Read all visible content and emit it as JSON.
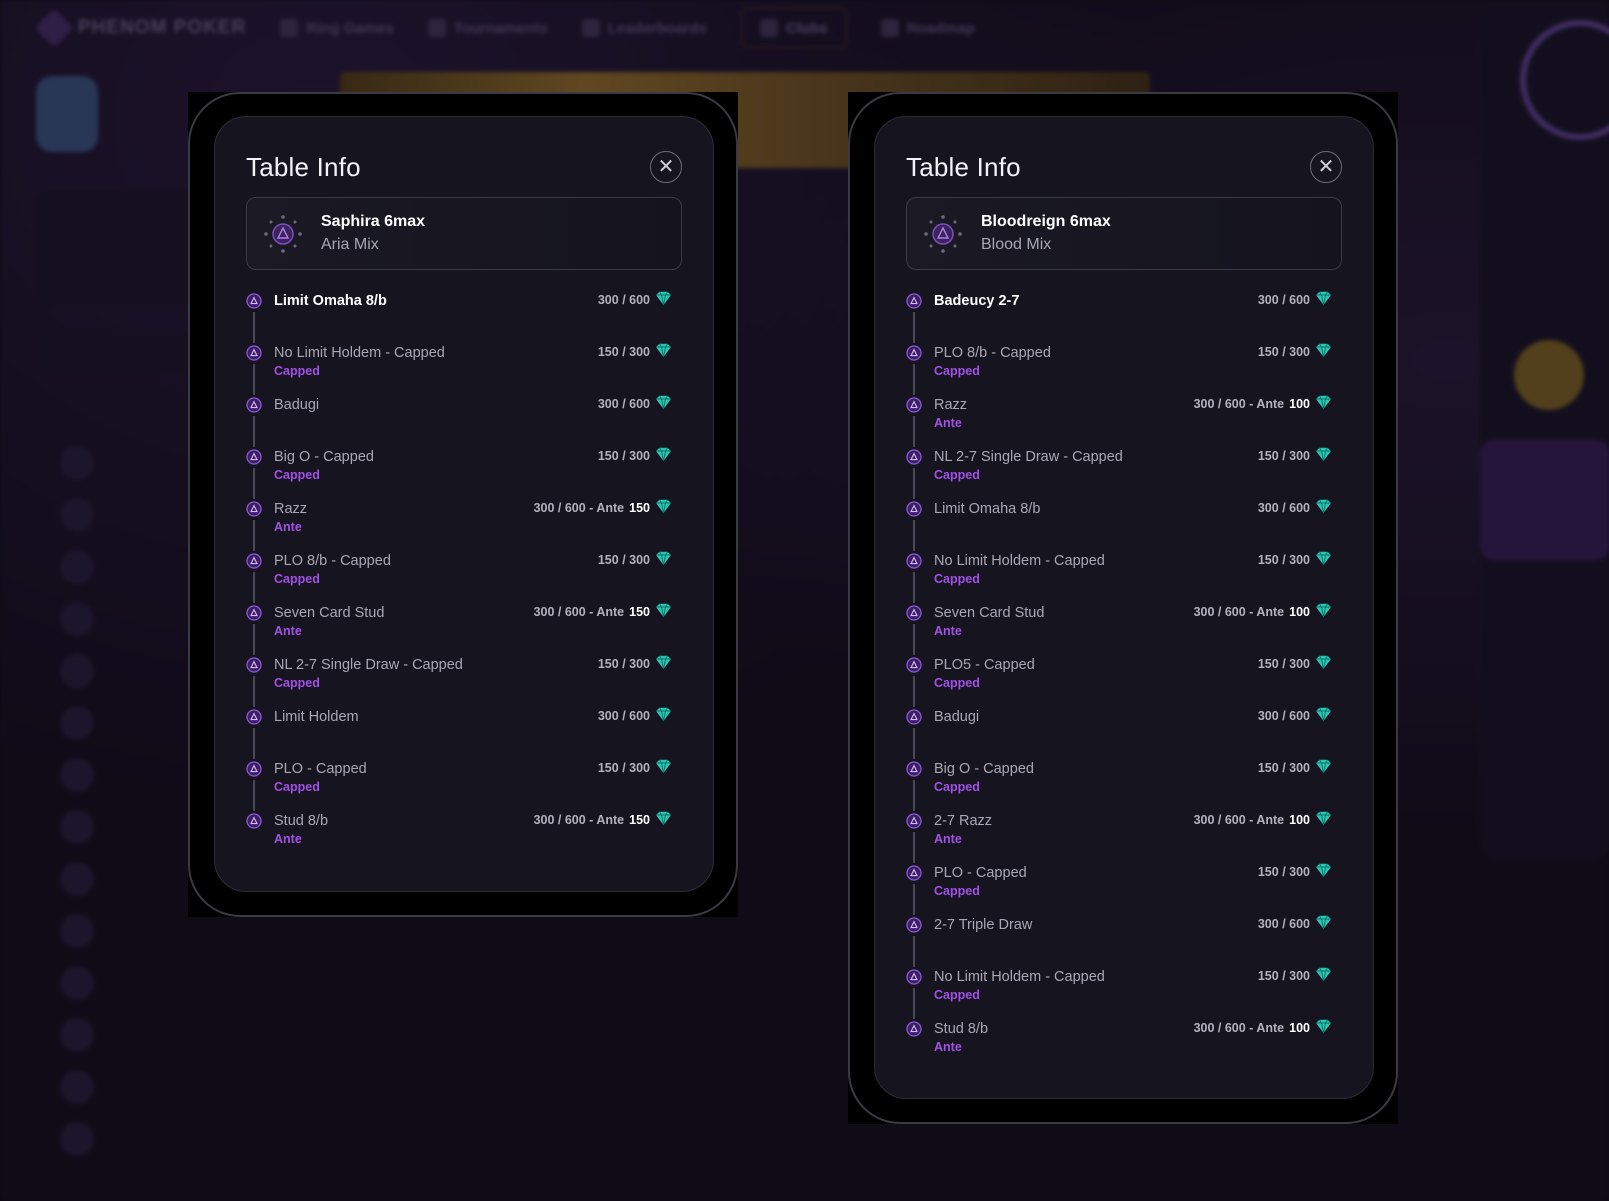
{
  "colors": {
    "accent_purple": "#a24fe6",
    "gem_teal": "#29c6b3",
    "modal_bg": "#16151f"
  },
  "background": {
    "brand": "PHENOM POKER",
    "nav": [
      "Ring Games",
      "Tournaments",
      "Leaderboards",
      "Clubs",
      "Roadmap"
    ]
  },
  "modals": [
    {
      "title": "Table Info",
      "close_icon": "close-icon",
      "table": {
        "name": "Saphira 6max",
        "mix": "Aria Mix"
      },
      "games": [
        {
          "name": "Limit Omaha 8/b",
          "sub": "",
          "stakes": "300 / 600",
          "ante": ""
        },
        {
          "name": "No Limit Holdem - Capped",
          "sub": "Capped",
          "stakes": "150 / 300",
          "ante": ""
        },
        {
          "name": "Badugi",
          "sub": "",
          "stakes": "300 / 600",
          "ante": ""
        },
        {
          "name": "Big O - Capped",
          "sub": "Capped",
          "stakes": "150 / 300",
          "ante": ""
        },
        {
          "name": "Razz",
          "sub": "Ante",
          "stakes": "300 / 600 - Ante",
          "ante": "150"
        },
        {
          "name": "PLO 8/b - Capped",
          "sub": "Capped",
          "stakes": "150 / 300",
          "ante": ""
        },
        {
          "name": "Seven Card Stud",
          "sub": "Ante",
          "stakes": "300 / 600 - Ante",
          "ante": "150"
        },
        {
          "name": "NL 2-7 Single Draw - Capped",
          "sub": "Capped",
          "stakes": "150 / 300",
          "ante": ""
        },
        {
          "name": "Limit Holdem",
          "sub": "",
          "stakes": "300 / 600",
          "ante": ""
        },
        {
          "name": "PLO - Capped",
          "sub": "Capped",
          "stakes": "150 / 300",
          "ante": ""
        },
        {
          "name": "Stud 8/b",
          "sub": "Ante",
          "stakes": "300 / 600 - Ante",
          "ante": "150"
        }
      ]
    },
    {
      "title": "Table Info",
      "close_icon": "close-icon",
      "table": {
        "name": "Bloodreign 6max",
        "mix": "Blood Mix"
      },
      "games": [
        {
          "name": "Badeucy 2-7",
          "sub": "",
          "stakes": "300 / 600",
          "ante": ""
        },
        {
          "name": "PLO 8/b - Capped",
          "sub": "Capped",
          "stakes": "150 / 300",
          "ante": ""
        },
        {
          "name": "Razz",
          "sub": "Ante",
          "stakes": "300 / 600 - Ante",
          "ante": "100"
        },
        {
          "name": "NL 2-7 Single Draw - Capped",
          "sub": "Capped",
          "stakes": "150 / 300",
          "ante": ""
        },
        {
          "name": "Limit Omaha 8/b",
          "sub": "",
          "stakes": "300 / 600",
          "ante": ""
        },
        {
          "name": "No Limit Holdem - Capped",
          "sub": "Capped",
          "stakes": "150 / 300",
          "ante": ""
        },
        {
          "name": "Seven Card Stud",
          "sub": "Ante",
          "stakes": "300 / 600 - Ante",
          "ante": "100"
        },
        {
          "name": "PLO5 - Capped",
          "sub": "Capped",
          "stakes": "150 / 300",
          "ante": ""
        },
        {
          "name": "Badugi",
          "sub": "",
          "stakes": "300 / 600",
          "ante": ""
        },
        {
          "name": "Big O - Capped",
          "sub": "Capped",
          "stakes": "150 / 300",
          "ante": ""
        },
        {
          "name": "2-7 Razz",
          "sub": "Ante",
          "stakes": "300 / 600 - Ante",
          "ante": "100"
        },
        {
          "name": "PLO - Capped",
          "sub": "Capped",
          "stakes": "150 / 300",
          "ante": ""
        },
        {
          "name": "2-7 Triple Draw",
          "sub": "",
          "stakes": "300 / 600",
          "ante": ""
        },
        {
          "name": "No Limit Holdem - Capped",
          "sub": "Capped",
          "stakes": "150 / 300",
          "ante": ""
        },
        {
          "name": "Stud 8/b",
          "sub": "Ante",
          "stakes": "300 / 600 - Ante",
          "ante": "100"
        }
      ]
    }
  ]
}
